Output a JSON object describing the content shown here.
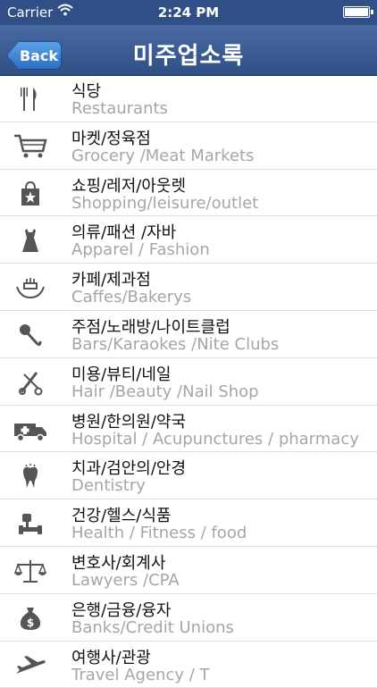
{
  "status": {
    "carrier": "Carrier",
    "time": "2:24 PM",
    "wifi_icon": "wifi-icon",
    "battery_icon": "battery-icon"
  },
  "nav": {
    "title": "미주업소록",
    "back_label": "Back"
  },
  "categories": [
    {
      "ko": "식당",
      "en": "Restaurants",
      "icon": "fork-knife-icon"
    },
    {
      "ko": "마켓/정육점",
      "en": "Grocery /Meat Markets",
      "icon": "shopping-cart-icon"
    },
    {
      "ko": "쇼핑/레저/아웃렛",
      "en": "Shopping/leisure/outlet",
      "icon": "shopping-bag-icon"
    },
    {
      "ko": "의류/패션 /자바",
      "en": "Apparel / Fashion",
      "icon": "dress-icon"
    },
    {
      "ko": "카페/제과점",
      "en": "Caffes/Bakerys",
      "icon": "cake-hands-icon"
    },
    {
      "ko": "주점/노래방/나이트클럽",
      "en": "Bars/Karaokes /Nite Clubs",
      "icon": "microphone-icon"
    },
    {
      "ko": "미용/뷰티/네일",
      "en": "Hair /Beauty /Nail Shop",
      "icon": "scissors-comb-icon"
    },
    {
      "ko": "병원/한의원/약국",
      "en": "Hospital / Acupunctures / pharmacy",
      "icon": "ambulance-icon"
    },
    {
      "ko": "치과/검안의/안경",
      "en": "Dentistry",
      "icon": "tooth-icon"
    },
    {
      "ko": "건강/헬스/식품",
      "en": "Health / Fitness / food",
      "icon": "dumbbell-icon"
    },
    {
      "ko": "변호사/회계사",
      "en": "Lawyers /CPA",
      "icon": "scales-icon"
    },
    {
      "ko": "은행/금융/융자",
      "en": "Banks/Credit Unions",
      "icon": "money-bag-icon"
    },
    {
      "ko": "여행사/관광",
      "en": "Travel Agency / T",
      "icon": "airplane-icon"
    }
  ]
}
